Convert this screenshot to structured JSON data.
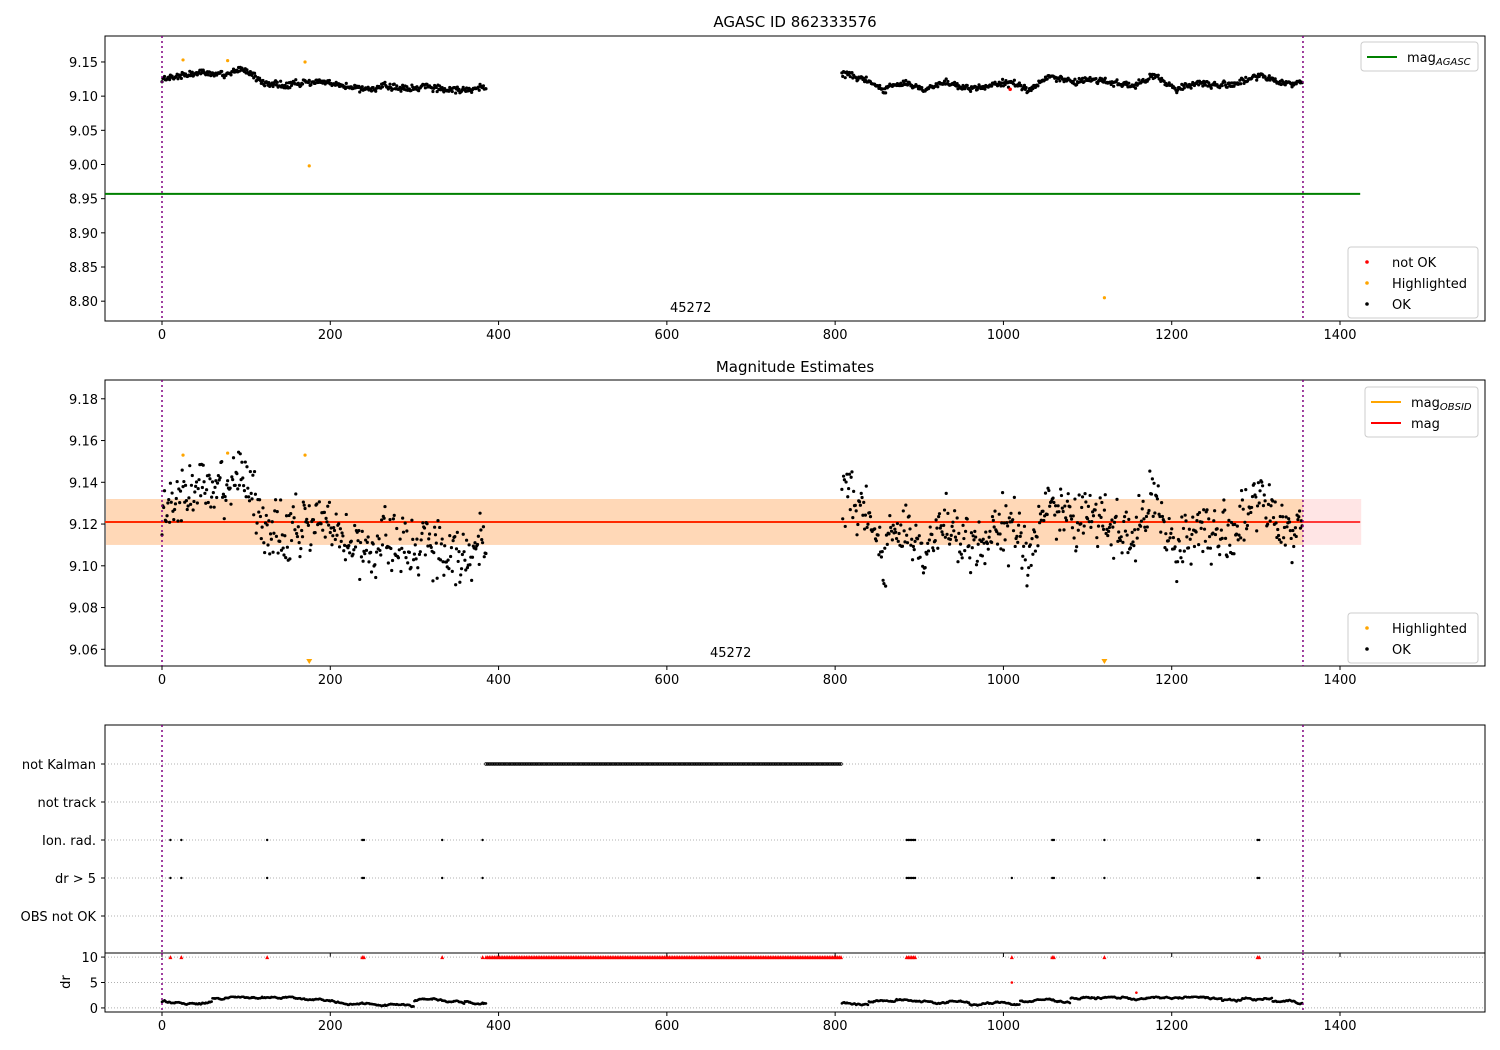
{
  "chart_data": [
    {
      "type": "scatter",
      "title": "AGASC ID 862333576",
      "xlim": [
        -67.7,
        1572
      ],
      "ylim": [
        8.771,
        9.188
      ],
      "yticks": [
        8.8,
        8.85,
        8.9,
        8.95,
        9.0,
        9.05,
        9.1,
        9.15
      ],
      "xticks": [
        0,
        200,
        400,
        600,
        800,
        1000,
        1200,
        1400
      ],
      "annotation": "45272",
      "vlines": [
        0,
        1356
      ],
      "mag_agasc": {
        "value": 8.957,
        "x_range": [
          -67.7,
          1424
        ],
        "color": "#008000"
      },
      "ok_segments": [
        {
          "x_start": 0,
          "x_end": 385,
          "levels": [
            9.125,
            9.13,
            9.135,
            9.13,
            9.14,
            9.12,
            9.115,
            9.12,
            9.12,
            9.115,
            9.11,
            9.115,
            9.11,
            9.115,
            9.11,
            9.11,
            9.112
          ]
        },
        {
          "x_start": 808,
          "x_end": 1355,
          "levels": [
            9.135,
            9.125,
            9.11,
            9.12,
            9.11,
            9.12,
            9.11,
            9.115,
            9.12,
            9.11,
            9.13,
            9.12,
            9.125,
            9.12,
            9.115,
            9.13,
            9.11,
            9.12,
            9.115,
            9.12,
            9.13,
            9.12,
            9.12
          ]
        }
      ],
      "ok_noise": 0.007,
      "highlighted": [
        [
          25,
          9.153
        ],
        [
          78,
          9.152
        ],
        [
          170,
          9.15
        ],
        [
          175,
          8.998
        ],
        [
          1120,
          8.805
        ]
      ],
      "not_ok": [
        [
          1008,
          9.11
        ]
      ],
      "legend_lines": [
        {
          "label": "mag",
          "sub": "AGASC",
          "color": "#008000"
        }
      ],
      "legend_points": [
        {
          "label": "not OK",
          "color": "#ff0000"
        },
        {
          "label": "Highlighted",
          "color": "#ffa500"
        },
        {
          "label": "OK",
          "color": "#000000"
        }
      ]
    },
    {
      "type": "scatter",
      "title": "Magnitude Estimates",
      "xlim": [
        -67.7,
        1572
      ],
      "ylim": [
        9.052,
        9.189
      ],
      "yticks": [
        9.06,
        9.08,
        9.1,
        9.12,
        9.14,
        9.16,
        9.18
      ],
      "xticks": [
        0,
        200,
        400,
        600,
        800,
        1000,
        1200,
        1400
      ],
      "annotation": "45272",
      "vlines": [
        0,
        1356
      ],
      "mag": {
        "value": 9.121,
        "band": [
          9.11,
          9.132
        ],
        "x_range": [
          -67.7,
          1424
        ],
        "color": "#ff0000"
      },
      "mag_obsid": {
        "value": 9.121,
        "band": [
          9.11,
          9.132
        ],
        "x_range": [
          -67.7,
          1355
        ],
        "color": "#ffa500"
      },
      "ok_noise": 0.011,
      "highlighted": [
        [
          25,
          9.153
        ],
        [
          78,
          9.154
        ],
        [
          170,
          9.153
        ]
      ],
      "highlighted_offscale": [
        175,
        1120
      ],
      "legend_lines": [
        {
          "label": "mag",
          "sub": "OBSID",
          "color": "#ffa500"
        },
        {
          "label": "mag",
          "sub": "",
          "color": "#ff0000"
        }
      ],
      "legend_points": [
        {
          "label": "Highlighted",
          "color": "#ffa500"
        },
        {
          "label": "OK",
          "color": "#000000"
        }
      ]
    },
    {
      "type": "scatter",
      "categories": [
        "not Kalman",
        "not track",
        "Ion. rad.",
        "dr > 5",
        "OBS not OK"
      ],
      "not_kalman_range": [
        385,
        808
      ],
      "ion_rad": [
        10,
        23,
        125,
        238,
        240,
        333,
        381,
        885,
        887,
        889,
        891,
        893,
        895,
        1058,
        1060,
        1120,
        1302,
        1304
      ],
      "dr_gt5": [
        10,
        23,
        125,
        238,
        240,
        333,
        381,
        885,
        887,
        889,
        891,
        893,
        895,
        1010,
        1058,
        1060,
        1120,
        1302,
        1304
      ],
      "vlines": [
        0,
        1356
      ]
    },
    {
      "type": "scatter",
      "ylabel": "dr",
      "yticks": [
        0,
        5,
        10
      ],
      "ylim": [
        -0.8,
        10.8
      ],
      "xticks": [
        0,
        200,
        400,
        600,
        800,
        1000,
        1200,
        1400
      ],
      "capped_at": 10,
      "dr_outliers": [
        [
          1010,
          5
        ],
        [
          1158,
          3
        ]
      ],
      "vlines": [
        0,
        1356
      ]
    }
  ]
}
